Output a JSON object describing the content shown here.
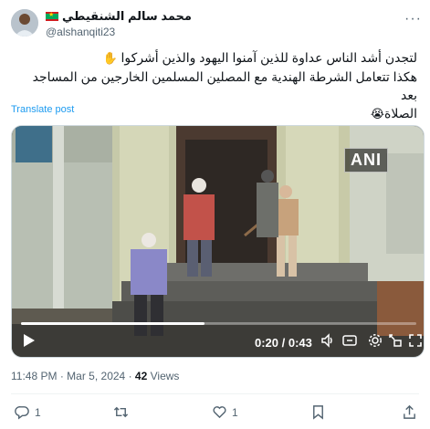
{
  "author": {
    "display_name": "محمد سالم الشنقيطي",
    "handle": "@alshanqiti23",
    "flag_icon": "mauritania-flag-icon"
  },
  "tweet": {
    "text_line1": "لتجدن أشد الناس عداوة للذين آمنوا اليهود والذين أشركوا",
    "text_line1_emoji": "✋",
    "text_line2": "هكذا تتعامل الشرطة الهندية مع المصلين المسلمين الخارجين من المساجد بعد",
    "text_line3": "الصلاة",
    "text_line3_emoji": "😭",
    "translate_label": "Translate post"
  },
  "video": {
    "watermark": "ANI",
    "time_display": "0:20 / 0:43",
    "progress": 0.465
  },
  "meta": {
    "time": "11:48 PM",
    "separator": "·",
    "date": "Mar 5, 2024",
    "separator2": "·",
    "views_count": "42",
    "views_label": "Views"
  },
  "actions": {
    "reply_count": "1",
    "retweet_count": "",
    "like_count": "1",
    "bookmark_count": ""
  },
  "colors": {
    "link": "#1d9bf0",
    "secondary_text": "#536471",
    "primary_text": "#0f1419"
  }
}
